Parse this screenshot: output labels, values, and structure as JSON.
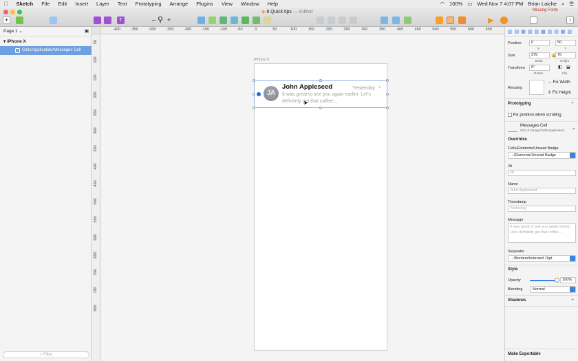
{
  "menubar": {
    "app": "Sketch",
    "items": [
      "File",
      "Edit",
      "Insert",
      "Layer",
      "Text",
      "Prototyping",
      "Arrange",
      "Plugins",
      "View",
      "Window",
      "Help"
    ],
    "battery": "100%",
    "clock": "Wed Nov 7  4:07 PM",
    "user": "Brian Laiche"
  },
  "toolbar": {
    "doc_title": "8 Quick tips",
    "doc_status": "— Edited",
    "missing_fonts": "Missing Fonts",
    "zoom_minus": "–",
    "zoom_plus": "+"
  },
  "leftpanel": {
    "page": "Page 1",
    "layer_group": "iPhone X",
    "layer_selected": "Cells/Application/Messages Cell",
    "filter_placeholder": "Filter"
  },
  "ruler": {
    "h_ticks": [
      "-400",
      "-350",
      "-300",
      "-250",
      "-200",
      "-150",
      "-100",
      "-50",
      "0",
      "50",
      "100",
      "150",
      "200",
      "250",
      "300",
      "350",
      "400",
      "450",
      "500",
      "550",
      "600",
      "650"
    ],
    "v_ticks": [
      "50",
      "100",
      "150",
      "200",
      "250",
      "300",
      "350",
      "400",
      "450",
      "500",
      "550",
      "600",
      "650",
      "700",
      "750",
      "800"
    ]
  },
  "canvas": {
    "artboard_label": "iPhone X",
    "cell": {
      "avatar": "JA",
      "name": "John Appleseed",
      "time": "Yesterday",
      "chevron": "›",
      "message": "It was great to see you again earlier. Let's definitely get that coffee..."
    }
  },
  "inspector": {
    "position_label": "Position",
    "x": "0",
    "y": "50",
    "x_lbl": "X",
    "y_lbl": "Y",
    "size_label": "Size",
    "width": "375",
    "height": "76",
    "width_lbl": "Width",
    "height_lbl": "Height",
    "transform_label": "Transform",
    "rotate": "0°",
    "rotate_lbl": "Rotate",
    "flip_lbl": "Flip",
    "resizing_label": "Resizing",
    "fix_width": "Fix Width",
    "fix_height": "Fix Height",
    "prototyping": "Prototyping",
    "fix_position": "Fix position when scrolling",
    "symbol_name": "Messages Cell",
    "symbol_path": "iOS UI Design/Cells/Application/",
    "overrides": "Overrides",
    "unread_label": "Cells/Elements/Unread Badge",
    "unread_value": ".../Elements/Unread Badge",
    "ja_label": "JA",
    "ja_placeholder": "JA",
    "name_label": "Name",
    "name_placeholder": "John Appleseed",
    "timestamp_label": "Timestamp",
    "timestamp_placeholder": "Yesterday",
    "message_label": "Message",
    "message_placeholder": "It was great to see you again earlier. Let's definitely get that coffee...",
    "separator_label": "Separator",
    "separator_value": ".../Borders/Indented 16pt",
    "style": "Style",
    "opacity_label": "Opacity",
    "opacity_value": "100%",
    "blending_label": "Blending",
    "blending_value": "Normal",
    "shadows": "Shadows",
    "make_exportable": "Make Exportable"
  },
  "colors": {
    "selection": "#6da0e0",
    "unread": "#1c6ce0",
    "accent": "#3b82e6"
  }
}
